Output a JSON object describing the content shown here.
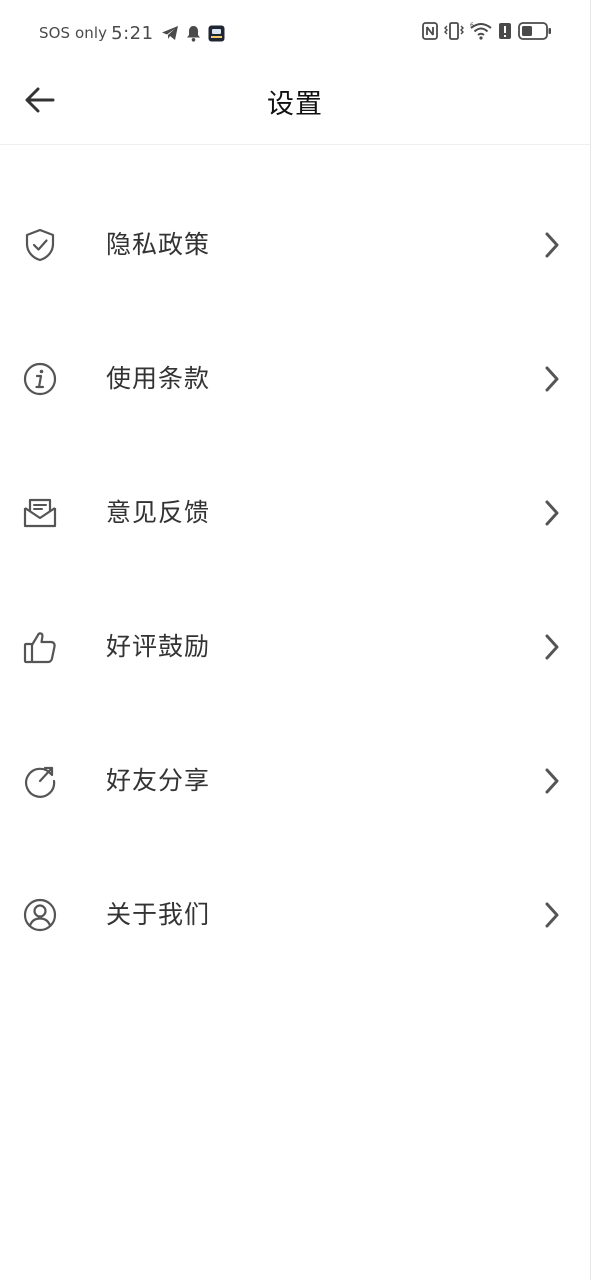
{
  "status_bar": {
    "carrier": "SOS only",
    "time": "5:21",
    "icons_left": [
      "telegram-icon",
      "bell-icon",
      "app-notification-icon"
    ],
    "icons_right": [
      "nfc-icon",
      "vibrate-icon",
      "wifi-icon",
      "battery-alert-icon",
      "battery-icon"
    ]
  },
  "header": {
    "title": "设置",
    "back_icon": "arrow-left-icon"
  },
  "menu": {
    "items": [
      {
        "label": "隐私政策",
        "icon": "shield-check-icon"
      },
      {
        "label": "使用条款",
        "icon": "info-icon"
      },
      {
        "label": "意见反馈",
        "icon": "mail-open-icon"
      },
      {
        "label": "好评鼓励",
        "icon": "thumbs-up-icon"
      },
      {
        "label": "好友分享",
        "icon": "share-refresh-icon"
      },
      {
        "label": "关于我们",
        "icon": "user-circle-icon"
      }
    ],
    "chevron_icon": "chevron-right-icon"
  },
  "colors": {
    "icon_stroke": "#555555",
    "label_text": "#333333",
    "title_text": "#111111",
    "divider": "#eeeeee",
    "background": "#ffffff"
  }
}
